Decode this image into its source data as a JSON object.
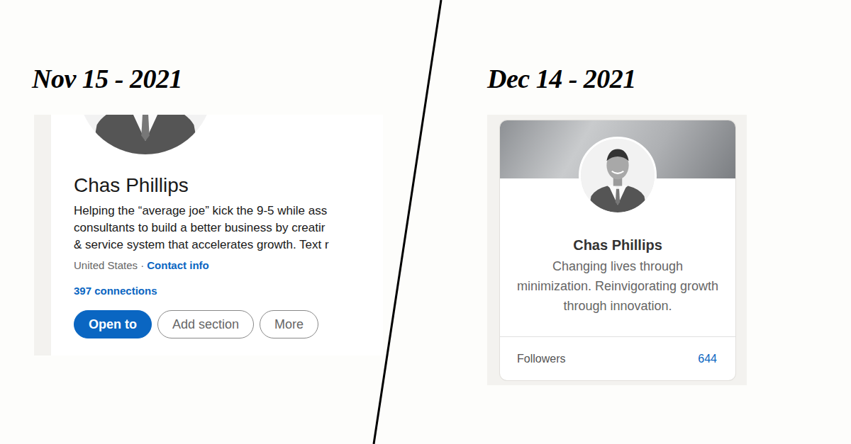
{
  "before": {
    "date": "Nov 15 - 2021",
    "profile": {
      "name": "Chas Phillips",
      "headline_lines": [
        "Helping the “average joe” kick the 9-5 while ass",
        "consultants to build a better business by creatir",
        "& service system that accelerates growth. Text r"
      ],
      "location": "United States ·",
      "contact": "Contact info",
      "connections": "397 connections",
      "buttons": [
        {
          "label": "Open to",
          "kind": "primary"
        },
        {
          "label": "Add section",
          "kind": "outline"
        },
        {
          "label": "More",
          "kind": "outline"
        }
      ]
    }
  },
  "after": {
    "date": "Dec 14 - 2021",
    "profile": {
      "name": "Chas Phillips",
      "headline": "Changing lives through minimization. Reinvigorating growth through innovation.",
      "followers_label": "Followers",
      "followers_count": "644"
    }
  }
}
